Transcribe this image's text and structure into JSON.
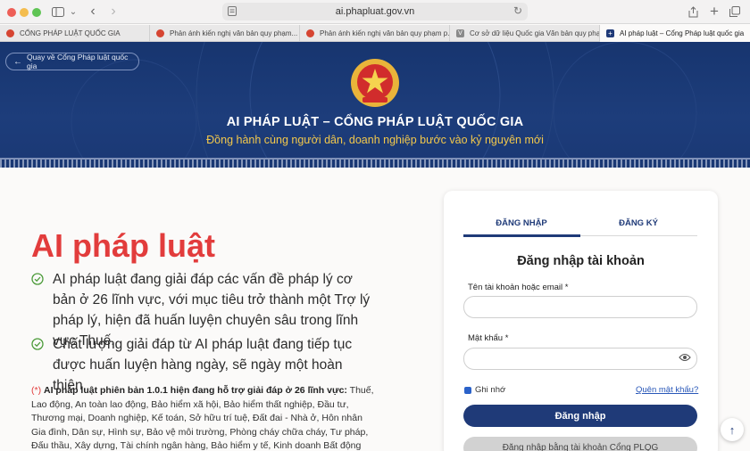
{
  "browser": {
    "url": "ai.phapluat.gov.vn",
    "tabs": [
      {
        "title": "CỔNG PHÁP LUẬT QUỐC GIA",
        "fav_color": "#d64532"
      },
      {
        "title": "Phản ánh kiến nghị văn bản quy phạm...",
        "fav_color": "#d64532"
      },
      {
        "title": "Phản ánh kiến nghị văn bản quy phạm p...",
        "fav_color": "#d64532"
      },
      {
        "title": "Cơ sở dữ liệu Quốc gia Văn bản quy phạ...",
        "fav_color": "#8a8a8a",
        "fav_letter": "V"
      },
      {
        "title": "AI pháp luật – Cổng Pháp luật quốc gia",
        "fav_color": "#1f3a78",
        "fav_letter": "+"
      }
    ]
  },
  "banner": {
    "back_label": "Quay về Cổng Pháp luật quốc gia",
    "title": "AI PHÁP LUẬT – CỔNG PHÁP LUẬT QUỐC GIA",
    "subtitle": "Đồng hành cùng người dân, doanh nghiệp bước vào kỷ nguyên mới"
  },
  "main": {
    "heading": "AI pháp luật",
    "bullets": [
      "AI pháp luật đang giải đáp các vấn đề pháp lý cơ bản ở 26 lĩnh vực, với mục tiêu trở thành một Trợ lý pháp lý, hiện đã huấn luyện chuyên sâu trong lĩnh vực Thuế.",
      "Chất lượng giải đáp từ AI pháp luật đang tiếp tục được huấn luyện hàng ngày, sẽ ngày một hoàn thiện."
    ],
    "note_star": "(*)",
    "note_bold": "AI pháp luật phiên bản 1.0.1 hiện đang hỗ trợ giải đáp ở 26 lĩnh vực:",
    "note_text": "Thuế, Lao động, An toàn lao động, Bảo hiểm xã hội, Bảo hiểm thất nghiệp, Đầu tư, Thương mại, Doanh nghiệp, Kế toán, Sở hữu trí tuệ, Đất đai - Nhà ở, Hôn nhân Gia đình, Dân sự, Hình sự, Bảo vệ môi trường, Phòng cháy chữa cháy, Tư pháp, Đấu thầu, Xây dựng, Tài chính ngân hàng, Bảo hiểm y tế, Kinh doanh Bất động sản, Hóa"
  },
  "login": {
    "tab_login": "ĐĂNG NHẬP",
    "tab_register": "ĐĂNG KÝ",
    "title": "Đăng nhập tài khoản",
    "username_label": "Tên tài khoản hoặc email *",
    "username_value": "",
    "password_label": "Mật khẩu *",
    "password_value": "",
    "remember_label": "Ghi nhớ",
    "forgot_label": "Quên mật khẩu?",
    "login_button": "Đăng nhập",
    "alt_button": "Đăng nhập bằng tài khoản Cổng PLQG"
  },
  "colors": {
    "brand_navy": "#1f3a78",
    "accent_red": "#e23c3c",
    "accent_gold": "#f3c84b"
  }
}
